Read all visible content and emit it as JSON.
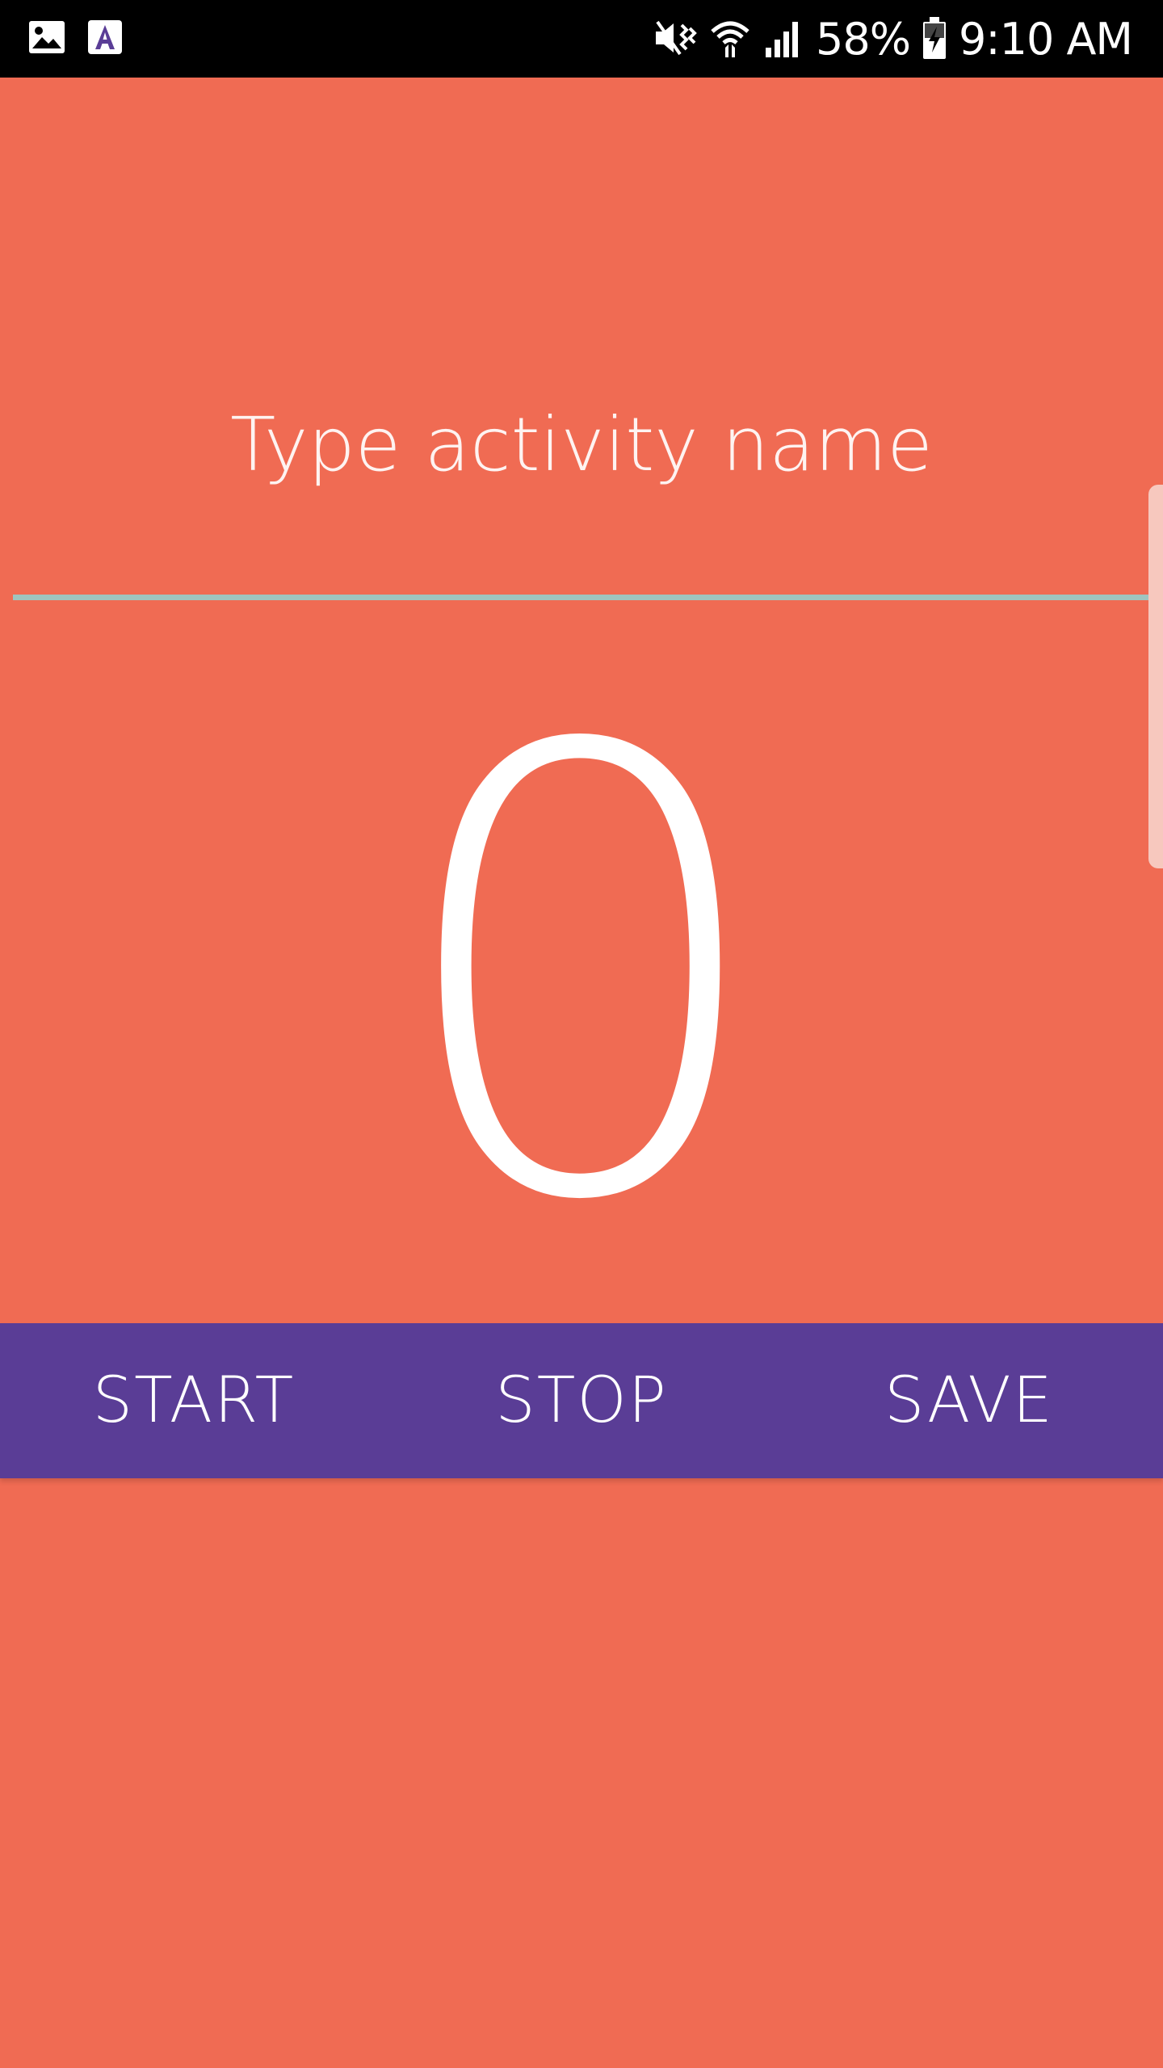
{
  "status_bar": {
    "left_icons": [
      "image-icon",
      "app-a-icon"
    ],
    "right_icons": [
      "mute-vibrate-icon",
      "wifi-icon",
      "signal-icon",
      "battery-charging-icon"
    ],
    "battery_percent": "58%",
    "time": "9:10 AM"
  },
  "activity": {
    "placeholder": "Type activity name",
    "value": ""
  },
  "counter": {
    "value": "0"
  },
  "buttons": {
    "start_label": "START",
    "stop_label": "STOP",
    "save_label": "SAVE"
  },
  "colors": {
    "background": "#F06B53",
    "button_bar": "#5A3D96",
    "underline": "#9FC4BF",
    "text": "#FFFFFF"
  }
}
